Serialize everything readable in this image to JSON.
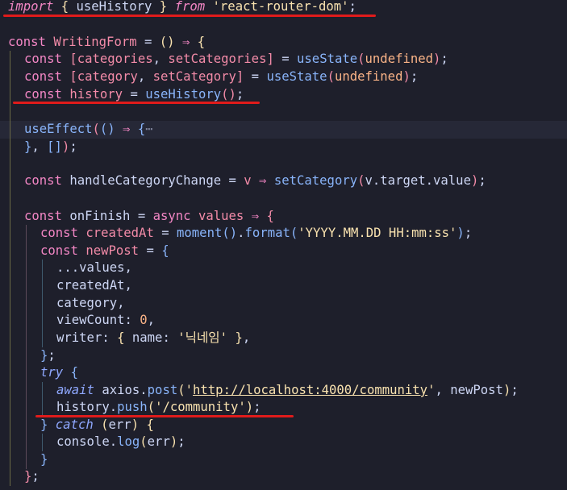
{
  "editor": {
    "language": "javascript",
    "theme": "dark",
    "colors": {
      "background": "#1e1f2b",
      "annotation_underline": "#e01b1b"
    },
    "lines": [
      {
        "indent": 0,
        "tokens": [
          {
            "t": "import",
            "c": "kwi"
          },
          {
            "t": " ",
            "c": "p"
          },
          {
            "t": "{",
            "c": "b1"
          },
          {
            "t": " useHistory ",
            "c": "id"
          },
          {
            "t": "}",
            "c": "b1"
          },
          {
            "t": " ",
            "c": "p"
          },
          {
            "t": "from",
            "c": "kwi"
          },
          {
            "t": " ",
            "c": "p"
          },
          {
            "t": "'react-router-dom'",
            "c": "str"
          },
          {
            "t": ";",
            "c": "p"
          }
        ]
      },
      {
        "indent": 0,
        "tokens": []
      },
      {
        "indent": 0,
        "tokens": [
          {
            "t": "const",
            "c": "kw"
          },
          {
            "t": " ",
            "c": "p"
          },
          {
            "t": "WritingForm",
            "c": "var"
          },
          {
            "t": " = ",
            "c": "p"
          },
          {
            "t": "()",
            "c": "b1"
          },
          {
            "t": " ⇒ ",
            "c": "kw"
          },
          {
            "t": "{",
            "c": "b1"
          }
        ]
      },
      {
        "indent": 1,
        "tokens": [
          {
            "t": "const",
            "c": "kw"
          },
          {
            "t": " ",
            "c": "p"
          },
          {
            "t": "[",
            "c": "b2"
          },
          {
            "t": "categories",
            "c": "var"
          },
          {
            "t": ", ",
            "c": "p"
          },
          {
            "t": "setCategories",
            "c": "var"
          },
          {
            "t": "]",
            "c": "b2"
          },
          {
            "t": " = ",
            "c": "p"
          },
          {
            "t": "useState",
            "c": "fn"
          },
          {
            "t": "(",
            "c": "b2"
          },
          {
            "t": "undefined",
            "c": "num"
          },
          {
            "t": ")",
            "c": "b2"
          },
          {
            "t": ";",
            "c": "p"
          }
        ]
      },
      {
        "indent": 1,
        "tokens": [
          {
            "t": "const",
            "c": "kw"
          },
          {
            "t": " ",
            "c": "p"
          },
          {
            "t": "[",
            "c": "b2"
          },
          {
            "t": "category",
            "c": "var"
          },
          {
            "t": ", ",
            "c": "p"
          },
          {
            "t": "setCategory",
            "c": "var"
          },
          {
            "t": "]",
            "c": "b2"
          },
          {
            "t": " = ",
            "c": "p"
          },
          {
            "t": "useState",
            "c": "fn"
          },
          {
            "t": "(",
            "c": "b2"
          },
          {
            "t": "undefined",
            "c": "num"
          },
          {
            "t": ")",
            "c": "b2"
          },
          {
            "t": ";",
            "c": "p"
          }
        ]
      },
      {
        "indent": 1,
        "tokens": [
          {
            "t": "const",
            "c": "kw"
          },
          {
            "t": " ",
            "c": "p"
          },
          {
            "t": "history",
            "c": "var"
          },
          {
            "t": " = ",
            "c": "p"
          },
          {
            "t": "useHistory",
            "c": "fn"
          },
          {
            "t": "()",
            "c": "b2"
          },
          {
            "t": ";",
            "c": "p"
          }
        ]
      },
      {
        "indent": 1,
        "tokens": []
      },
      {
        "indent": 1,
        "highlight": true,
        "tokens": [
          {
            "t": "useEffect",
            "c": "fn"
          },
          {
            "t": "(",
            "c": "b2"
          },
          {
            "t": "()",
            "c": "b3"
          },
          {
            "t": " ⇒ ",
            "c": "kw"
          },
          {
            "t": "{",
            "c": "b3"
          },
          {
            "t": "⋯",
            "c": "cm"
          }
        ]
      },
      {
        "indent": 1,
        "tokens": [
          {
            "t": "}",
            "c": "b3"
          },
          {
            "t": ", ",
            "c": "p"
          },
          {
            "t": "[]",
            "c": "b3"
          },
          {
            "t": ")",
            "c": "b2"
          },
          {
            "t": ";",
            "c": "p"
          }
        ]
      },
      {
        "indent": 1,
        "tokens": []
      },
      {
        "indent": 1,
        "tokens": [
          {
            "t": "const",
            "c": "kw"
          },
          {
            "t": " ",
            "c": "p"
          },
          {
            "t": "handleCategoryChange",
            "c": "id"
          },
          {
            "t": " = ",
            "c": "p"
          },
          {
            "t": "v",
            "c": "var"
          },
          {
            "t": " ⇒ ",
            "c": "kw"
          },
          {
            "t": "setCategory",
            "c": "fn"
          },
          {
            "t": "(",
            "c": "b2"
          },
          {
            "t": "v.target.value",
            "c": "id"
          },
          {
            "t": ")",
            "c": "b2"
          },
          {
            "t": ";",
            "c": "p"
          }
        ]
      },
      {
        "indent": 1,
        "tokens": []
      },
      {
        "indent": 1,
        "tokens": [
          {
            "t": "const",
            "c": "kw"
          },
          {
            "t": " ",
            "c": "p"
          },
          {
            "t": "onFinish",
            "c": "id"
          },
          {
            "t": " = ",
            "c": "p"
          },
          {
            "t": "async",
            "c": "kw"
          },
          {
            "t": " ",
            "c": "p"
          },
          {
            "t": "values",
            "c": "var"
          },
          {
            "t": " ⇒ ",
            "c": "kw"
          },
          {
            "t": "{",
            "c": "b2"
          }
        ]
      },
      {
        "indent": 2,
        "tokens": [
          {
            "t": "const",
            "c": "kw"
          },
          {
            "t": " ",
            "c": "p"
          },
          {
            "t": "createdAt",
            "c": "var"
          },
          {
            "t": " = ",
            "c": "p"
          },
          {
            "t": "moment",
            "c": "fn"
          },
          {
            "t": "()",
            "c": "b3"
          },
          {
            "t": ".",
            "c": "p"
          },
          {
            "t": "format",
            "c": "fn"
          },
          {
            "t": "(",
            "c": "b3"
          },
          {
            "t": "'YYYY.MM.DD HH:mm:ss'",
            "c": "str"
          },
          {
            "t": ")",
            "c": "b3"
          },
          {
            "t": ";",
            "c": "p"
          }
        ]
      },
      {
        "indent": 2,
        "tokens": [
          {
            "t": "const",
            "c": "kw"
          },
          {
            "t": " ",
            "c": "p"
          },
          {
            "t": "newPost",
            "c": "var"
          },
          {
            "t": " = ",
            "c": "p"
          },
          {
            "t": "{",
            "c": "b3"
          }
        ]
      },
      {
        "indent": 3,
        "tokens": [
          {
            "t": "...values,",
            "c": "id"
          }
        ]
      },
      {
        "indent": 3,
        "tokens": [
          {
            "t": "createdAt,",
            "c": "id"
          }
        ]
      },
      {
        "indent": 3,
        "tokens": [
          {
            "t": "category,",
            "c": "id"
          }
        ]
      },
      {
        "indent": 3,
        "tokens": [
          {
            "t": "viewCount: ",
            "c": "id"
          },
          {
            "t": "0",
            "c": "num"
          },
          {
            "t": ",",
            "c": "p"
          }
        ]
      },
      {
        "indent": 3,
        "tokens": [
          {
            "t": "writer: ",
            "c": "id"
          },
          {
            "t": "{",
            "c": "b1"
          },
          {
            "t": " name: ",
            "c": "id"
          },
          {
            "t": "'닉네임'",
            "c": "str"
          },
          {
            "t": " ",
            "c": "p"
          },
          {
            "t": "}",
            "c": "b1"
          },
          {
            "t": ",",
            "c": "p"
          }
        ]
      },
      {
        "indent": 2,
        "tokens": [
          {
            "t": "}",
            "c": "b3"
          },
          {
            "t": ";",
            "c": "p"
          }
        ]
      },
      {
        "indent": 2,
        "tokens": [
          {
            "t": "try",
            "c": "kwb"
          },
          {
            "t": " ",
            "c": "p"
          },
          {
            "t": "{",
            "c": "b3"
          }
        ]
      },
      {
        "indent": 3,
        "tokens": [
          {
            "t": "await",
            "c": "kwb"
          },
          {
            "t": " axios.",
            "c": "id"
          },
          {
            "t": "post",
            "c": "fn"
          },
          {
            "t": "(",
            "c": "b1"
          },
          {
            "t": "'",
            "c": "str"
          },
          {
            "t": "http://localhost:4000/community",
            "c": "str",
            "u": true
          },
          {
            "t": "'",
            "c": "str"
          },
          {
            "t": ", newPost",
            "c": "id"
          },
          {
            "t": ")",
            "c": "b1"
          },
          {
            "t": ";",
            "c": "p"
          }
        ]
      },
      {
        "indent": 3,
        "tokens": [
          {
            "t": "history",
            "c": "id"
          },
          {
            "t": ".",
            "c": "p"
          },
          {
            "t": "push",
            "c": "fn"
          },
          {
            "t": "(",
            "c": "b1"
          },
          {
            "t": "'/community'",
            "c": "str"
          },
          {
            "t": ")",
            "c": "b1"
          },
          {
            "t": ";",
            "c": "p"
          }
        ]
      },
      {
        "indent": 2,
        "tokens": [
          {
            "t": "}",
            "c": "b3"
          },
          {
            "t": " ",
            "c": "p"
          },
          {
            "t": "catch",
            "c": "kwb"
          },
          {
            "t": " ",
            "c": "p"
          },
          {
            "t": "(",
            "c": "b1"
          },
          {
            "t": "err",
            "c": "id"
          },
          {
            "t": ")",
            "c": "b1"
          },
          {
            "t": " ",
            "c": "p"
          },
          {
            "t": "{",
            "c": "b1"
          }
        ]
      },
      {
        "indent": 3,
        "tokens": [
          {
            "t": "console.",
            "c": "id"
          },
          {
            "t": "log",
            "c": "fn"
          },
          {
            "t": "(",
            "c": "b1"
          },
          {
            "t": "err",
            "c": "id"
          },
          {
            "t": ")",
            "c": "b1"
          },
          {
            "t": ";",
            "c": "p"
          }
        ]
      },
      {
        "indent": 2,
        "tokens": [
          {
            "t": "}",
            "c": "b3"
          }
        ]
      },
      {
        "indent": 1,
        "tokens": [
          {
            "t": "}",
            "c": "b2"
          },
          {
            "t": ";",
            "c": "p"
          }
        ]
      }
    ],
    "annotations": [
      {
        "label": "import-underline"
      },
      {
        "label": "history-declaration-underline"
      },
      {
        "label": "history-push-underline"
      }
    ]
  }
}
